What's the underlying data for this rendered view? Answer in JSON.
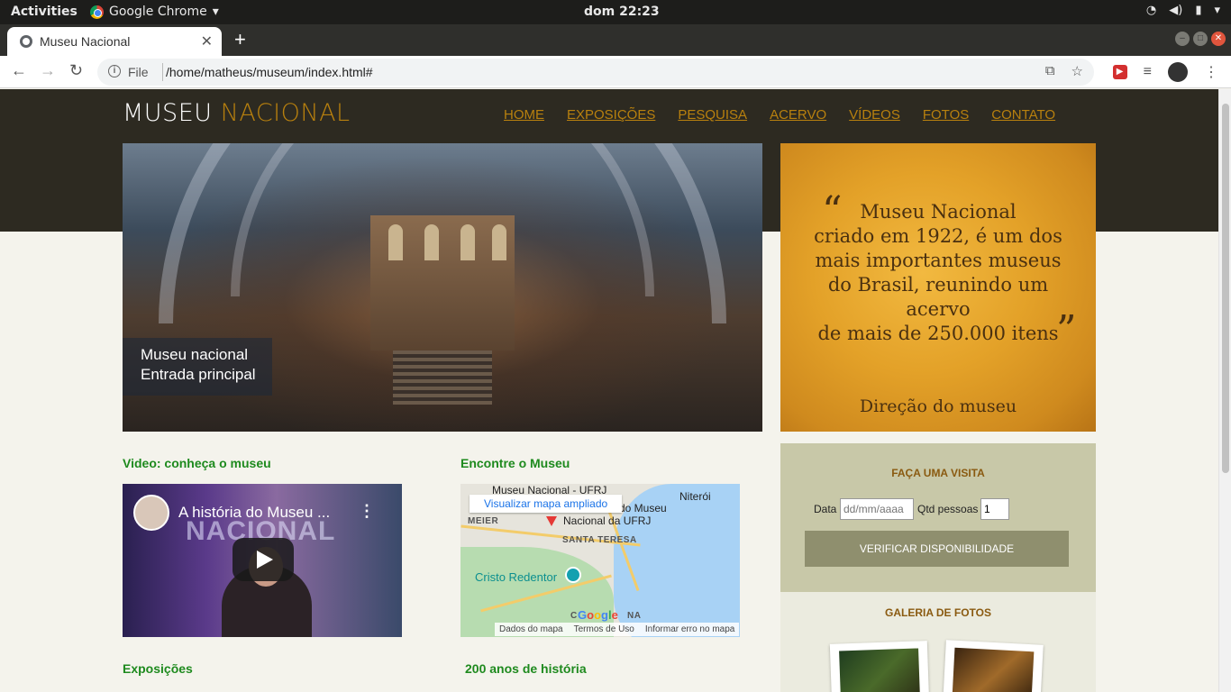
{
  "os": {
    "activities": "Activities",
    "app_name": "Google Chrome",
    "clock": "dom 22:23"
  },
  "browser": {
    "tab_title": "Museu Nacional",
    "url_scheme": "File",
    "url": "/home/matheus/museum/index.html#"
  },
  "site": {
    "logo_white": "MUSEU",
    "logo_gold": "NACIONAL",
    "nav": [
      "HOME",
      "EXPOSIÇÕES",
      "PESQUISA",
      "ACERVO",
      "VÍDEOS",
      "FOTOS",
      "CONTATO"
    ],
    "hero_caption_line1": "Museu nacional",
    "hero_caption_line2": "Entrada principal",
    "quote": {
      "open": "“",
      "close": "”",
      "lines": [
        "Museu Nacional",
        "criado em 1922, é um dos",
        "mais importantes museus",
        "do Brasil, reunindo um acervo",
        "de mais de 250.000 itens"
      ],
      "author": "Direção do museu"
    },
    "visit": {
      "title": "FAÇA UMA VISITA",
      "date_label": "Data",
      "date_placeholder": "dd/mm/aaaa",
      "qty_label": "Qtd pessoas",
      "qty_value": "1",
      "button": "VERIFICAR DISPONIBILIDADE"
    },
    "gallery": {
      "title": "GALERIA DE FOTOS"
    },
    "video_section": {
      "title": "Video: conheça o museu",
      "video_title": "A história do Museu ...",
      "video_overlay": "NACIONAL",
      "menu_glyph": "⋮"
    },
    "map_section": {
      "title": "Encontre o Museu",
      "link": "Visualizar mapa ampliado",
      "place_line1": "Museu Nacional - UFRJ",
      "place_line2": "do Museu",
      "place_line3": "Nacional da UFRJ",
      "label_niteroi": "Niterói",
      "label_meier": "MEIER",
      "label_santa": "SANTA TERESA",
      "label_cristo": "Cristo Redentor",
      "label_copa": "C",
      "label_na": "NA",
      "google": "Google",
      "attr": [
        "Dados do mapa",
        "Termos de Uso",
        "Informar erro no mapa"
      ]
    },
    "exposicoes_title": "Exposições",
    "historia_title": "200 anos de história"
  },
  "colors": {
    "header_bg": "#2d2a21",
    "gold": "#b8800e",
    "green_title": "#1e8a1e",
    "visit_bg": "#c8c8a8",
    "visit_button": "#8f8f6e"
  },
  "icons": [
    "back-icon",
    "forward-icon",
    "reload-icon",
    "info-icon",
    "translate-icon",
    "star-icon",
    "play-icon",
    "map-pin-icon"
  ]
}
